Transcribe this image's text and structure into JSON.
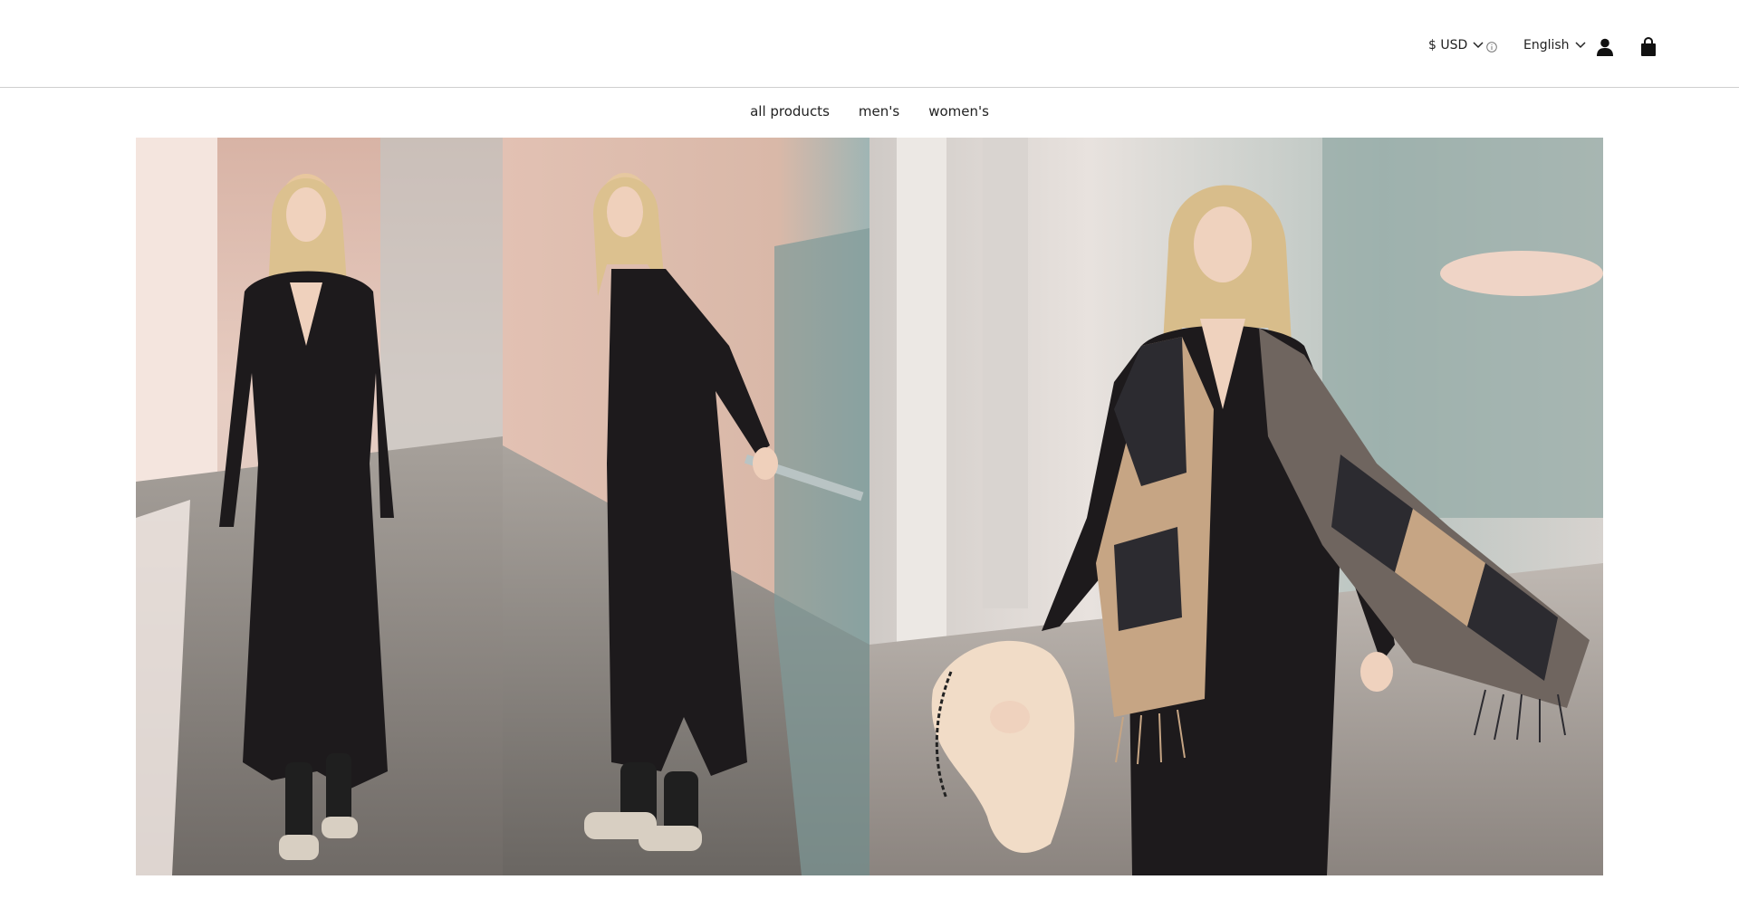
{
  "header": {
    "currency_label": "$ USD",
    "language_label": "English",
    "icons": {
      "currency_chevron": "chevron-down-icon",
      "currency_info": "info-icon",
      "language_chevron": "chevron-down-icon",
      "account": "user-icon",
      "cart": "shopping-bag-icon"
    }
  },
  "nav": {
    "items": [
      {
        "label": "all products"
      },
      {
        "label": "men's"
      },
      {
        "label": "women's"
      }
    ]
  },
  "hero": {
    "images": [
      {
        "name": "woman in black knit dress walking front view"
      },
      {
        "name": "woman in black knit dress leaning on glass railing"
      },
      {
        "name": "woman in black dress with plaid scarf and faux fur bag"
      }
    ]
  },
  "colors": {
    "text": "#111111",
    "divider": "#cfcfcf",
    "dress": "#1d1a1c",
    "scarf_beige": "#c6a584",
    "pavement": "#7d7975"
  }
}
